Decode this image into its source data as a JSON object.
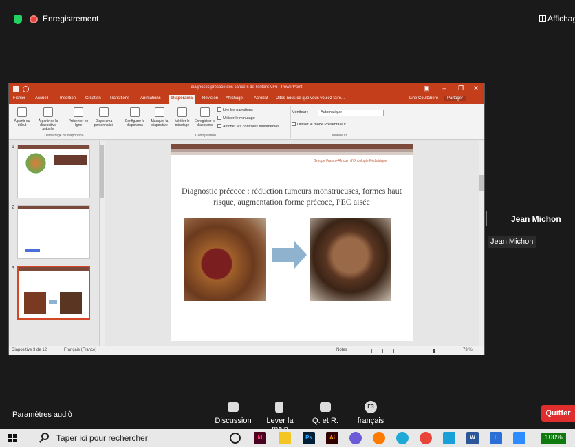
{
  "zoom": {
    "recording_label": "Enregistrement",
    "view_label": "Affichage",
    "participant_name": "Jean Michon",
    "participant_tag": "Jean Michon",
    "audio_settings": "Paramètres audio",
    "controls": {
      "discussion": "Discussion",
      "raise_hand": "Lever la main",
      "qa": "Q. et R.",
      "language_badge": "FR",
      "language": "français"
    },
    "quit": "Quitter"
  },
  "powerpoint": {
    "window_title": "diagnostic précoce des cancers de l'enfant VF6 - PowerPoint",
    "tabs": [
      "Fichier",
      "Accueil",
      "Insertion",
      "Création",
      "Transitions",
      "Animations",
      "Diaporama",
      "Révision",
      "Affichage",
      "Acrobat"
    ],
    "active_tab": "Diaporama",
    "tell_me": "Dites-nous ce que vous voulez faire...",
    "user": "Line Couitchere",
    "share": "Partager",
    "ribbon": {
      "start_from_beginning": "À partir du début",
      "from_current": "À partir de la diapositive actuelle",
      "present_online": "Présenter en ligne",
      "custom_show": "Diaporama personnalisé",
      "group_start": "Démarrage du diaporama",
      "setup_show": "Configurer le diaporama",
      "hide_slide": "Masquer la diapositive",
      "rehearse": "Vérifier le minutage",
      "record": "Enregistrer le diaporama",
      "chk_narrations": "Lire les narrations",
      "chk_timing": "Utiliser le minutage",
      "chk_controls": "Afficher les contrôles multimédias",
      "group_config": "Configuration",
      "monitor_label": "Moniteur :",
      "monitor_value": "Automatique",
      "chk_presenter": "Utiliser le mode Présentateur",
      "group_monitors": "Moniteurs"
    },
    "thumbnails": [
      {
        "num": "1"
      },
      {
        "num": "2"
      },
      {
        "num": "3"
      }
    ],
    "slide": {
      "org": "Groupe Franco-Africain d'Oncologie Pédiatrique",
      "title": "Diagnostic précoce : réduction tumeurs monstrueuses, formes haut risque, augmentation forme précoce, PEC aisée"
    },
    "status": {
      "slide_count": "Diapositive 3 de 12",
      "language": "Français (France)",
      "notes": "Notes",
      "zoom": "73 %"
    }
  },
  "taskbar": {
    "search_placeholder": "Taper ici pour rechercher",
    "battery": "100%"
  }
}
